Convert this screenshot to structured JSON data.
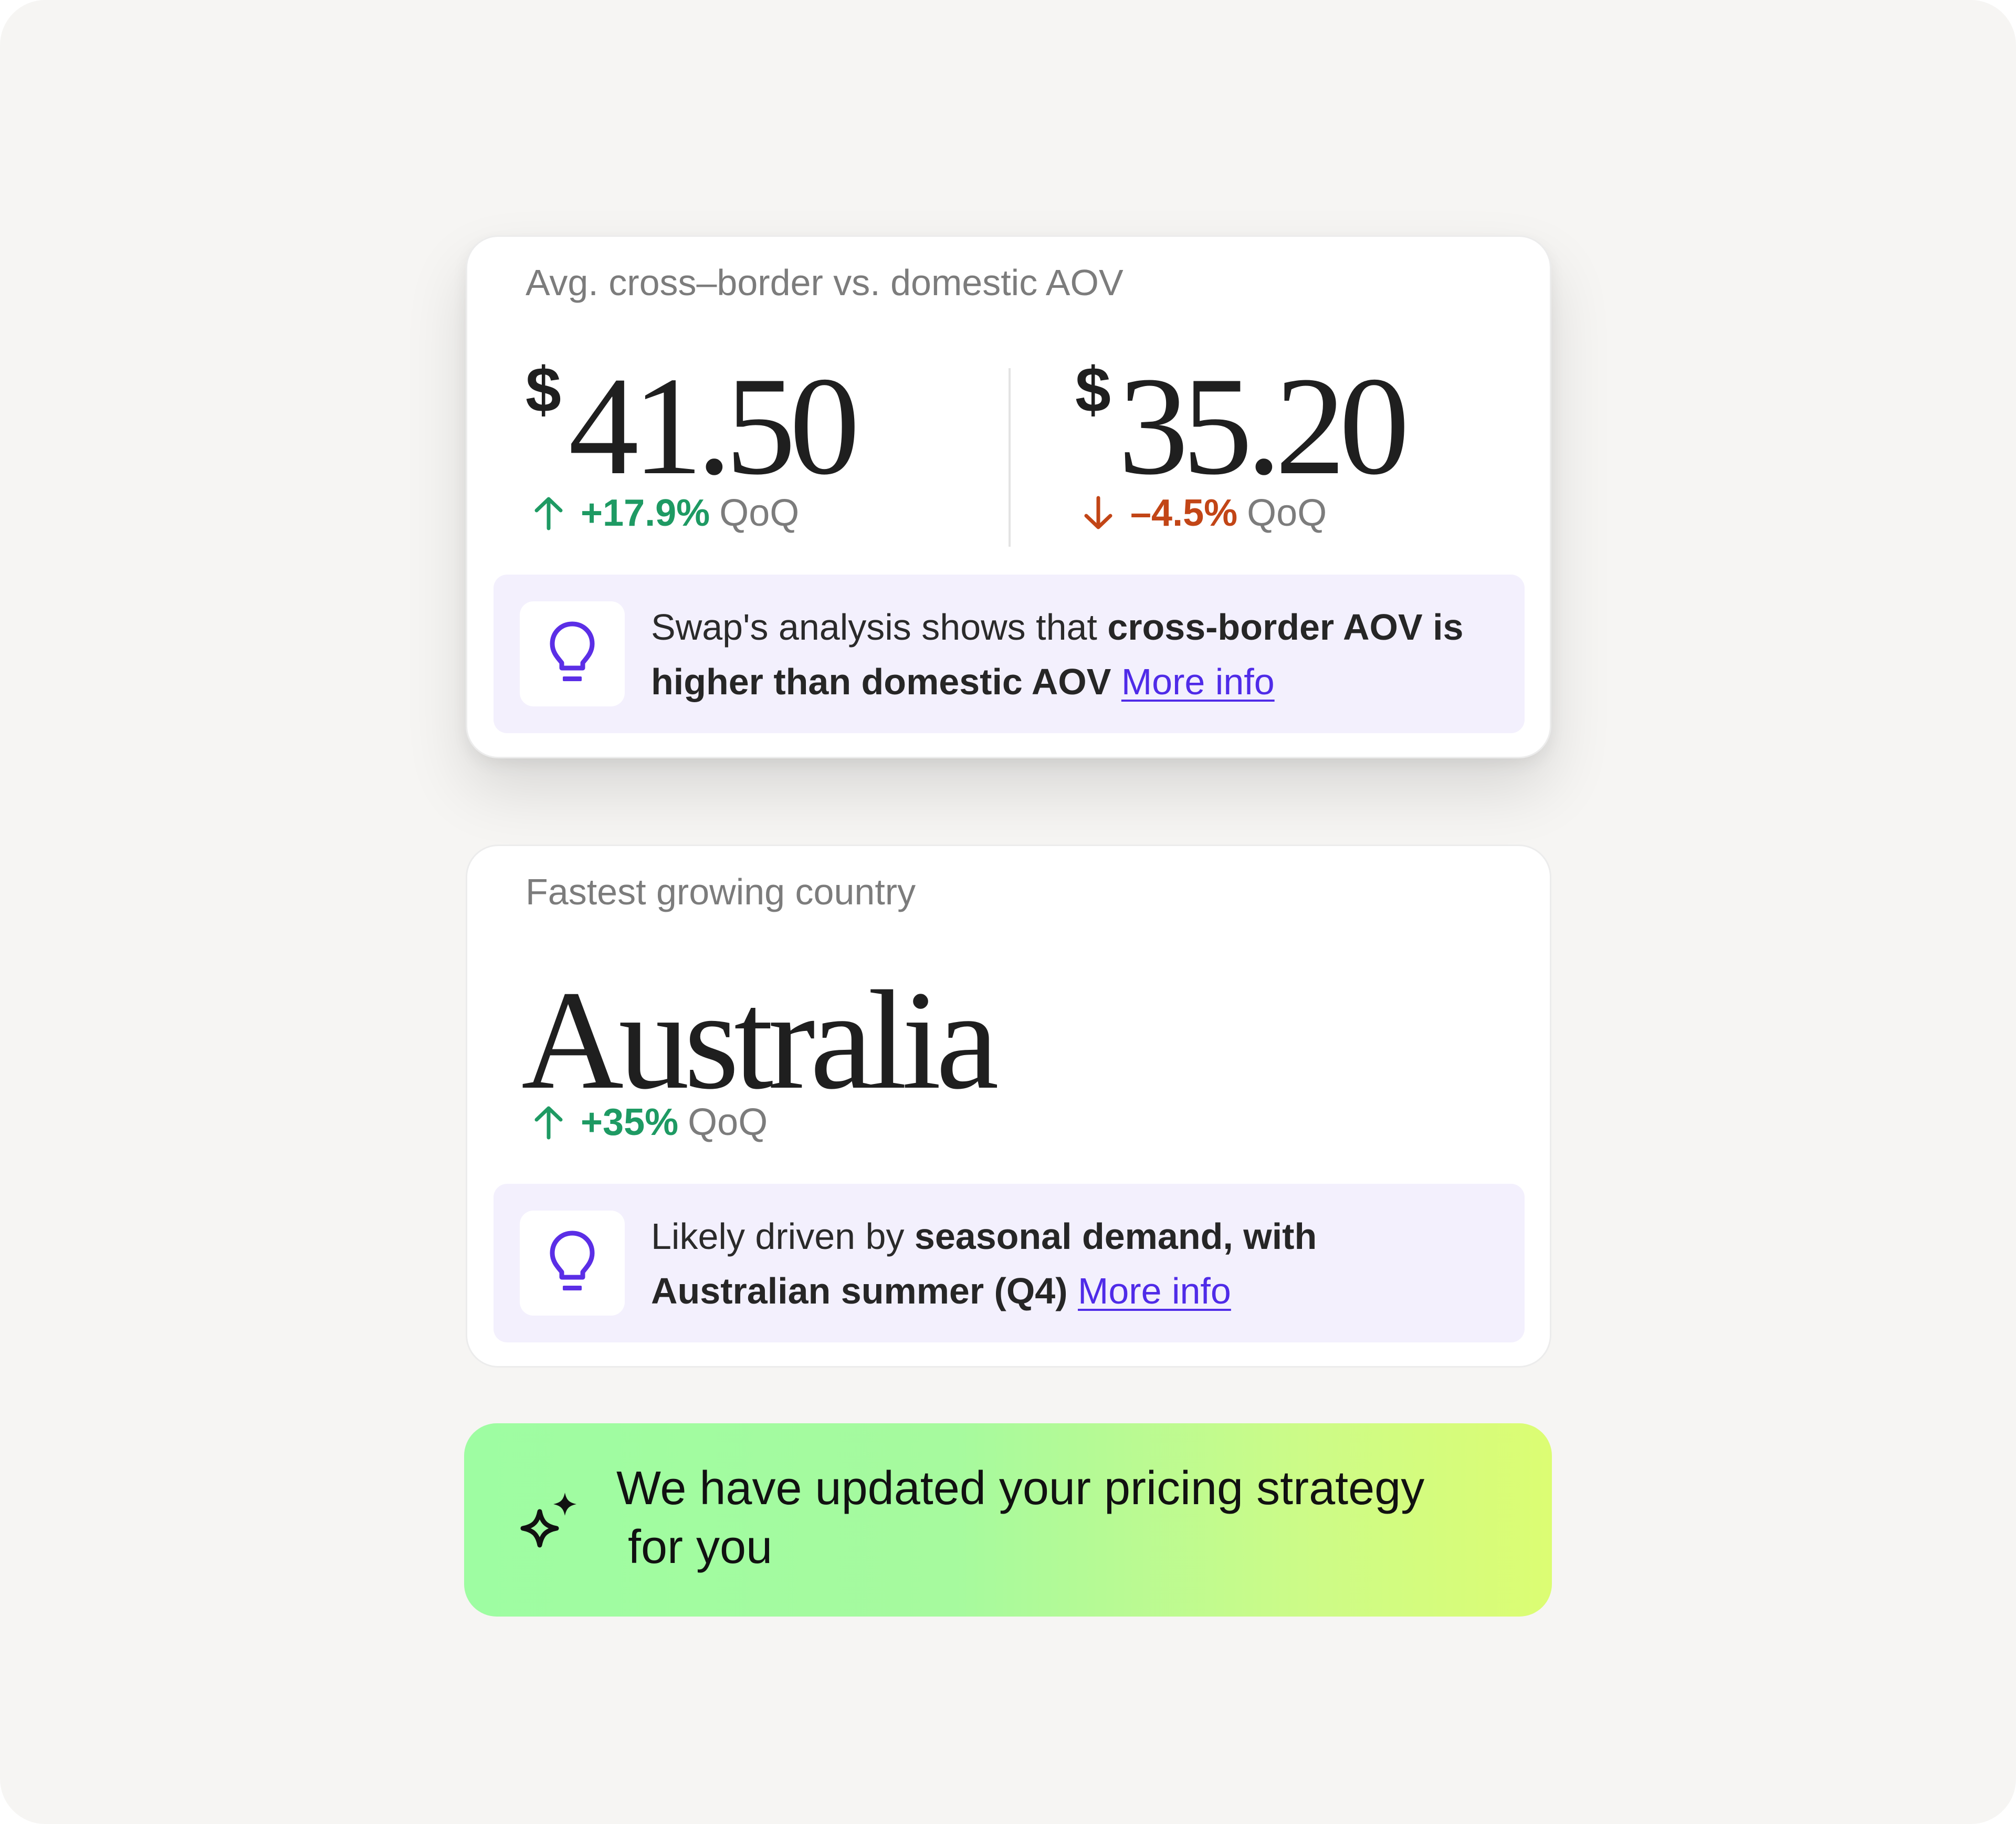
{
  "aov_card": {
    "label": "Avg. cross–border vs. domestic AOV",
    "left": {
      "currency": "$",
      "value": "41.50",
      "change": "+17.9%",
      "period": "QoQ",
      "direction": "up"
    },
    "right": {
      "currency": "$",
      "value": "35.20",
      "change": "–4.5%",
      "period": "QoQ",
      "direction": "down"
    },
    "insight": {
      "icon": "lightbulb-icon",
      "text_prefix": "Swap's analysis shows that ",
      "text_bold": "cross-border AOV is higher than domestic AOV",
      "link": "More info"
    }
  },
  "country_card": {
    "label": "Fastest growing country",
    "country": "Australia",
    "change": "+35%",
    "period": "QoQ",
    "direction": "up",
    "insight": {
      "icon": "lightbulb-icon",
      "text_prefix": "Likely driven by ",
      "text_bold": "seasonal demand, with Australian summer (Q4)",
      "link": "More info"
    }
  },
  "banner": {
    "icon": "sparkle-icon",
    "text_line1": "We have updated your pricing strategy",
    "text_line2": "for you"
  },
  "colors": {
    "positive": "#1e9a63",
    "negative": "#c24516",
    "accent": "#4f2be8",
    "insight_bg": "#f3f0fd",
    "background": "#f6f5f3"
  }
}
